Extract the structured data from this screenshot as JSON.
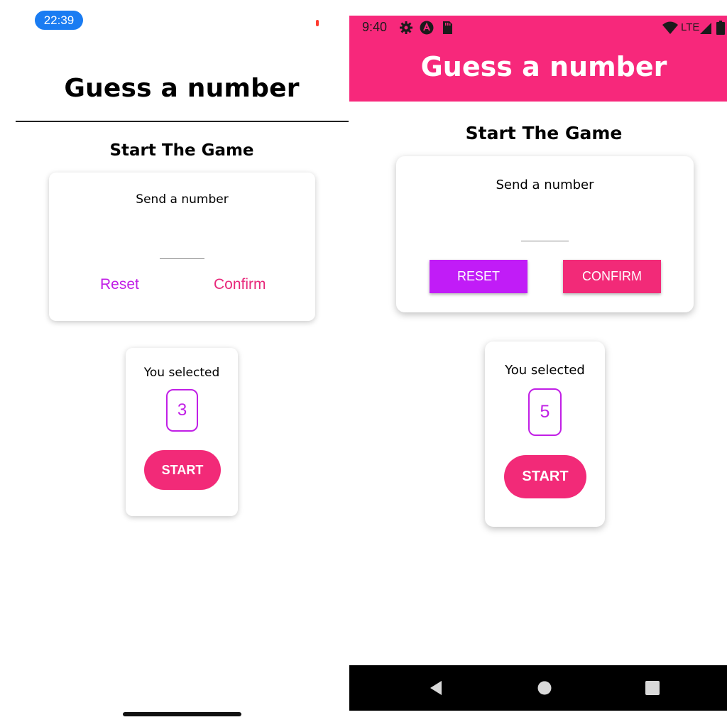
{
  "ios": {
    "status_time": "22:39",
    "header_title": "Guess a number",
    "subtitle": "Start The Game",
    "input_card": {
      "label": "Send a number",
      "input_value": "",
      "reset_label": "Reset",
      "confirm_label": "Confirm"
    },
    "summary_card": {
      "label": "You selected",
      "selected_number": "3",
      "start_label": "START"
    }
  },
  "android": {
    "status_time": "9:40",
    "network_label": "LTE",
    "header_title": "Guess a number",
    "subtitle": "Start The Game",
    "input_card": {
      "label": "Send a number",
      "input_value": "",
      "reset_label": "RESET",
      "confirm_label": "CONFIRM"
    },
    "summary_card": {
      "label": "You selected",
      "selected_number": "5",
      "start_label": "START"
    },
    "nav_icons": [
      "back-icon",
      "home-icon",
      "recents-icon"
    ]
  },
  "colors": {
    "primary_pink": "#f22a78",
    "accent_purple": "#c11cf7",
    "ios_pill_blue": "#1a7cf2",
    "android_header": "#f7287b"
  }
}
